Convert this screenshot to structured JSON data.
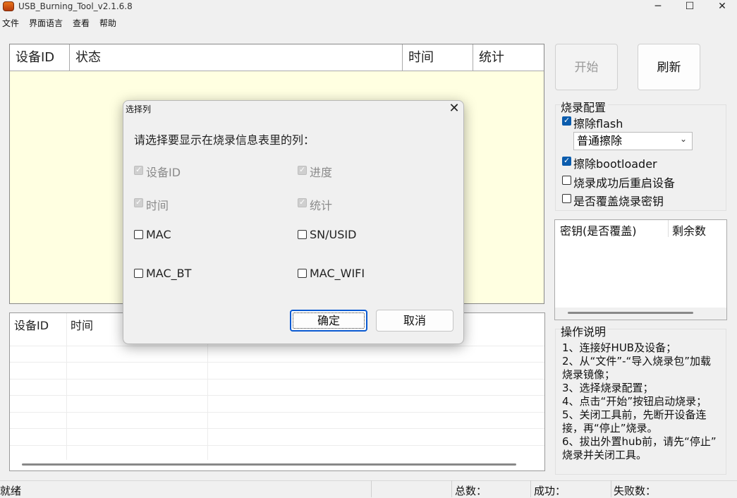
{
  "window": {
    "title": "USB_Burning_Tool_v2.1.6.8",
    "minimize": "─",
    "maximize": "☐",
    "close": "✕"
  },
  "menu": [
    "文件",
    "界面语言",
    "查看",
    "帮助"
  ],
  "top_table": {
    "columns": [
      "设备ID",
      "状态",
      "时间",
      "统计"
    ]
  },
  "bottom_table": {
    "columns": [
      "设备ID",
      "时间"
    ]
  },
  "right_panel": {
    "start_button": "开始",
    "refresh_button": "刷新",
    "config_title": "烧录配置",
    "erase_flash": {
      "label": "擦除flash",
      "checked": true
    },
    "erase_mode": "普通擦除",
    "erase_bootloader": {
      "label": "擦除bootloader",
      "checked": true
    },
    "reboot_after": {
      "label": "烧录成功后重启设备",
      "checked": false
    },
    "overwrite_key": {
      "label": "是否覆盖烧录密钥",
      "checked": false
    },
    "key_table": {
      "col1": "密钥(是否覆盖)",
      "col2": "剩余数"
    },
    "help_title": "操作说明",
    "help_lines": [
      "1、连接好HUB及设备；",
      "2、从“文件”-“导入烧录包”加载",
      "烧录镜像；",
      "3、选择烧录配置；",
      "4、点击“开始”按钮启动烧录；",
      "5、关闭工具前，先断开设备连",
      "接，再“停止”烧录。",
      "6、拔出外置hub前，请先“停止”",
      "烧录并关闭工具。"
    ]
  },
  "status_bar": {
    "ready": "就绪",
    "total": "总数：",
    "success": "成功：",
    "failed": "失败数："
  },
  "dialog": {
    "title": "选择列",
    "close": "✕",
    "prompt": "请选择要显示在烧录信息表里的列：",
    "options": [
      {
        "label": "设备ID",
        "checked": true,
        "disabled": true
      },
      {
        "label": "进度",
        "checked": true,
        "disabled": true
      },
      {
        "label": "时间",
        "checked": true,
        "disabled": true
      },
      {
        "label": "统计",
        "checked": true,
        "disabled": true
      },
      {
        "label": "MAC",
        "checked": false,
        "disabled": false
      },
      {
        "label": "SN/USID",
        "checked": false,
        "disabled": false
      },
      {
        "label": "MAC_BT",
        "checked": false,
        "disabled": false
      },
      {
        "label": "MAC_WIFI",
        "checked": false,
        "disabled": false
      }
    ],
    "ok": "确定",
    "cancel": "取消"
  }
}
